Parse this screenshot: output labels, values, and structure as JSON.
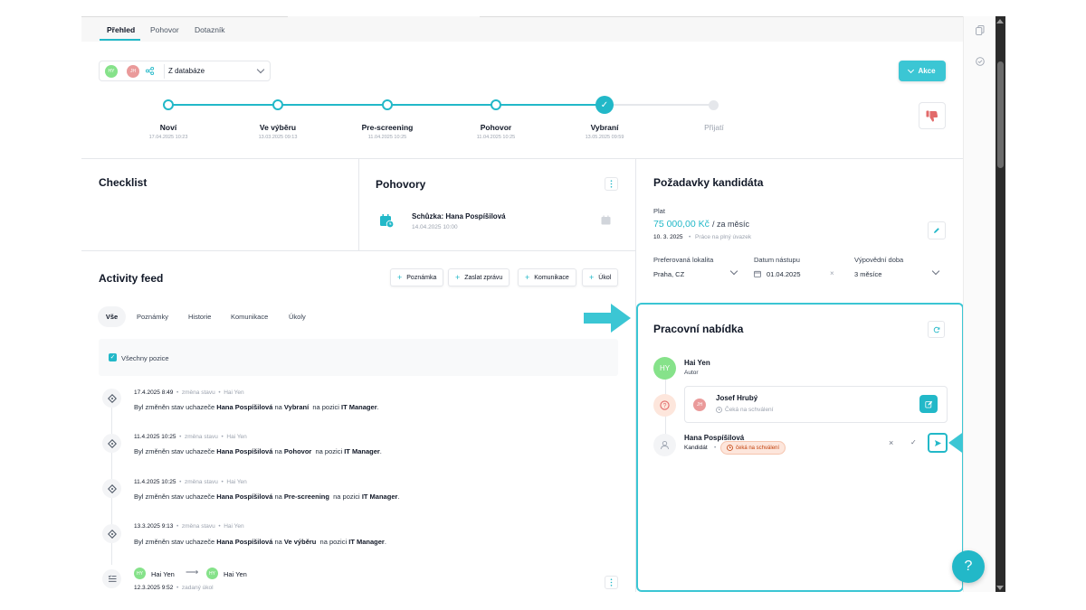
{
  "tabs": [
    "Přehled",
    "Pohovor",
    "Dotazník"
  ],
  "source": {
    "avatar1": "HY",
    "avatar2": "JH",
    "label": "Z databáze"
  },
  "actions_button": "Akce",
  "pipeline": [
    {
      "name": "Noví",
      "date": "17.04.2025 10:23"
    },
    {
      "name": "Ve výběru",
      "date": "13.03.2025 09:13"
    },
    {
      "name": "Pre-screening",
      "date": "11.04.2025 10:25"
    },
    {
      "name": "Pohovor",
      "date": "11.04.2025 10:25"
    },
    {
      "name": "Vybraní",
      "date": "13.05.2025 09:59"
    },
    {
      "name": "Přijatí",
      "date": ""
    }
  ],
  "checklist": {
    "title": "Checklist"
  },
  "interviews": {
    "title": "Pohovory",
    "item_title": "Schůzka: Hana Pospíšilová",
    "item_date": "14.04.2025 10:00"
  },
  "activity": {
    "title": "Activity feed",
    "buttons": [
      "Poznámka",
      "Zaslat zprávu",
      "Komunikace",
      "Úkol"
    ],
    "filters": [
      "Vše",
      "Poznámky",
      "Historie",
      "Komunikace",
      "Úkoly"
    ],
    "all_positions": "Všechny pozice",
    "events": [
      {
        "date": "17.4.2025 8:49",
        "type": "změna stavu",
        "author": "Hai Yen",
        "prefix": "Byl změněn stav uchazeče ",
        "candidate": "Hana Pospíšilová",
        "on": " na ",
        "stage": "Vybraní",
        "pos_prefix": "  na pozici ",
        "position": "IT Manager",
        "end": "."
      },
      {
        "date": "11.4.2025 10:25",
        "type": "změna stavu",
        "author": "Hai Yen",
        "prefix": "Byl změněn stav uchazeče ",
        "candidate": "Hana Pospíšilová",
        "on": " na ",
        "stage": "Pohovor",
        "pos_prefix": "  na pozici ",
        "position": "IT Manager",
        "end": "."
      },
      {
        "date": "11.4.2025 10:25",
        "type": "změna stavu",
        "author": "Hai Yen",
        "prefix": "Byl změněn stav uchazeče ",
        "candidate": "Hana Pospíšilová",
        "on": " na ",
        "stage": "Pre-screening",
        "pos_prefix": "  na pozici ",
        "position": "IT Manager",
        "end": "."
      },
      {
        "date": "13.3.2025 9:13",
        "type": "změna stavu",
        "author": "Hai Yen",
        "prefix": "Byl změněn stav uchazeče ",
        "candidate": "Hana Pospíšilová",
        "on": " na ",
        "stage": "Ve výběru",
        "pos_prefix": "  na pozici ",
        "position": "IT Manager",
        "end": "."
      }
    ],
    "task": {
      "from": "Hai Yen",
      "to": "Hai Yen",
      "date": "12.3.2025 9:52",
      "type": "zadaný úkol",
      "avatar": "HY"
    }
  },
  "requirements": {
    "title": "Požadavky kandidáta",
    "salary_label": "Plat",
    "salary_value": "75 000,00 Kč",
    "salary_period": "/ za měsíc",
    "salary_date": "10. 3. 2025",
    "salary_note": "Práce na plný úvazek",
    "location_label": "Preferovaná lokalita",
    "location_value": "Praha, CZ",
    "start_label": "Datum nástupu",
    "start_value": "01.04.2025",
    "notice_label": "Výpovědní doba",
    "notice_value": "3 měsíce"
  },
  "offer": {
    "title": "Pracovní nabídka",
    "author_avatar": "HY",
    "author_name": "Hai Yen",
    "author_role": "Autor",
    "approver_avatar": "JH",
    "approver_name": "Josef Hrubý",
    "approver_status": "Čeká na schválení",
    "candidate_name": "Hana Pospíšilová",
    "candidate_role": "Kandidát",
    "candidate_badge": "čeká na schválení"
  },
  "colors": {
    "accent": "#22b8c8",
    "arrow": "#3bc6d4",
    "danger": "#e26a6a"
  }
}
